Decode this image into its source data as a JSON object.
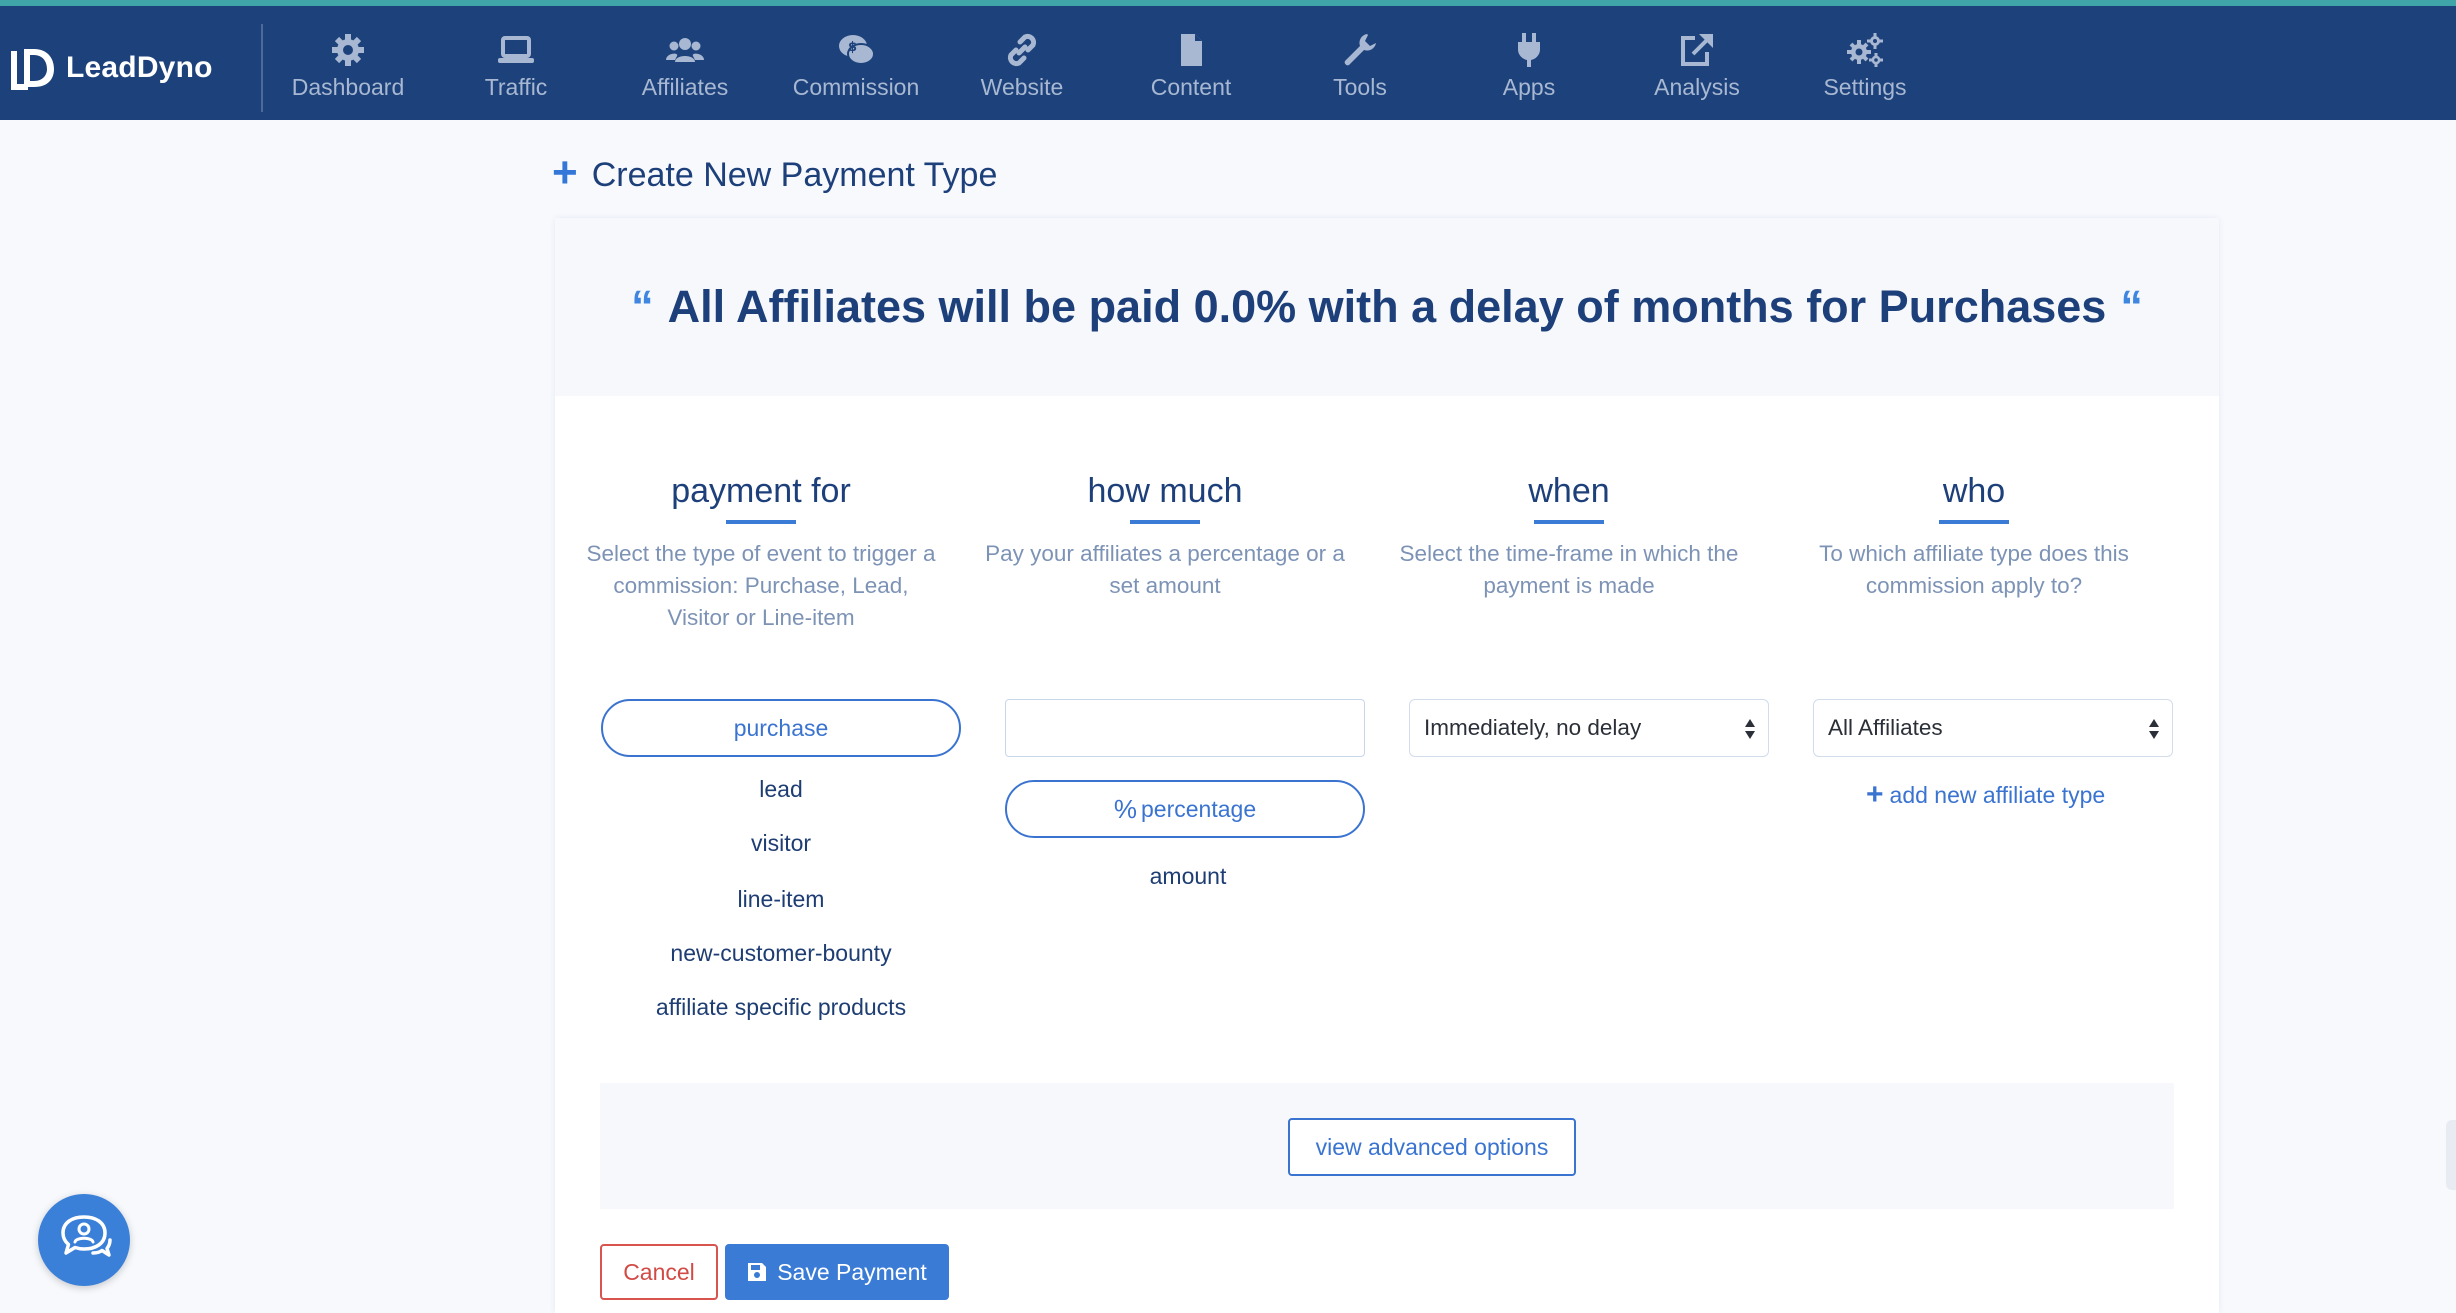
{
  "app": {
    "brand": "LeadDyno"
  },
  "nav": {
    "items": [
      {
        "label": "Dashboard",
        "icon": "gear-icon"
      },
      {
        "label": "Traffic",
        "icon": "laptop-icon"
      },
      {
        "label": "Affiliates",
        "icon": "users-icon"
      },
      {
        "label": "Commission",
        "icon": "money-icon"
      },
      {
        "label": "Website",
        "icon": "link-icon"
      },
      {
        "label": "Content",
        "icon": "file-icon"
      },
      {
        "label": "Tools",
        "icon": "wrench-icon"
      },
      {
        "label": "Apps",
        "icon": "plug-icon"
      },
      {
        "label": "Analysis",
        "icon": "external-link-icon"
      },
      {
        "label": "Settings",
        "icon": "cogs-icon"
      }
    ]
  },
  "page": {
    "title": "Create New Payment Type"
  },
  "summary": {
    "open_quote": "“",
    "text": "All Affiliates will be paid 0.0% with a delay of months for Purchases",
    "close_quote": "“"
  },
  "columns": {
    "payment_for": {
      "title": "payment for",
      "description": "Select the type of event to trigger a commission: Purchase, Lead, Visitor or Line-item",
      "selected": "purchase",
      "options": [
        "lead",
        "visitor",
        "line-item",
        "new-customer-bounty",
        "affiliate specific products"
      ]
    },
    "how_much": {
      "title": "how much",
      "description": "Pay your affiliates a percentage or a set amount",
      "amount_value": "",
      "selected": "percentage",
      "selected_symbol": "%",
      "options": [
        "amount"
      ]
    },
    "when": {
      "title": "when",
      "description": "Select the time-frame in which the payment is made",
      "selected": "Immediately, no delay"
    },
    "who": {
      "title": "who",
      "description": "To which affiliate type does this commission apply to?",
      "selected": "All Affiliates",
      "add_link": "add new affiliate type"
    }
  },
  "advanced": {
    "label": "view advanced options"
  },
  "actions": {
    "cancel": "Cancel",
    "save": "Save Payment"
  },
  "colors": {
    "navbar": "#1d427b",
    "accent": "#3a7bd5",
    "heading": "#1d3f7a",
    "danger": "#d9534f"
  }
}
